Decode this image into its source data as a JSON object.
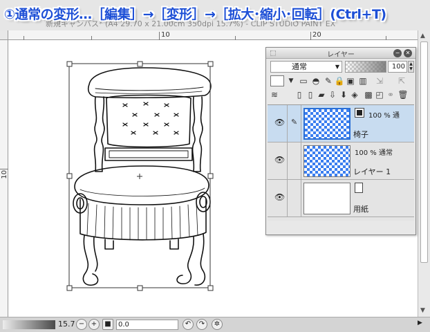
{
  "window": {
    "title": "新規キャンバス* (A4 29.70 x 21.00cm 350dpi 15.7%) - CLIP STUDIO PAINT EX"
  },
  "caption": "①通常の変形…［編集］→［変形］→［拡大･縮小･回転］(Ctrl+T)",
  "ruler": {
    "top_labels": [
      "10",
      "20"
    ],
    "left_labels": [
      "10"
    ]
  },
  "canvas": {
    "description_shown": "chair line drawing with transform bounding box"
  },
  "layer_panel": {
    "title": "レイヤー",
    "blend_mode": "通常",
    "opacity": "100",
    "layers": [
      {
        "opacity_mode": "100 % 通",
        "name": "椅子",
        "selected": true,
        "visible": true,
        "type": "raster"
      },
      {
        "opacity_mode": "100 % 通常",
        "name": "レイヤー 1",
        "selected": false,
        "visible": true,
        "type": "raster"
      },
      {
        "opacity_mode": "",
        "name": "用紙",
        "selected": false,
        "visible": true,
        "type": "paper"
      }
    ]
  },
  "statusbar": {
    "zoom": "15.7",
    "angle": "0.0"
  },
  "colors": {
    "caption": "#1d4fd6",
    "selected_layer": "#c8dcf0",
    "checker": "#3a7ef0"
  },
  "icons": [
    "eye-icon",
    "brush-icon",
    "zoom-out-icon",
    "zoom-in-icon",
    "rotate-left-icon",
    "rotate-right-icon",
    "reset-icon",
    "minimize-icon",
    "close-icon"
  ]
}
